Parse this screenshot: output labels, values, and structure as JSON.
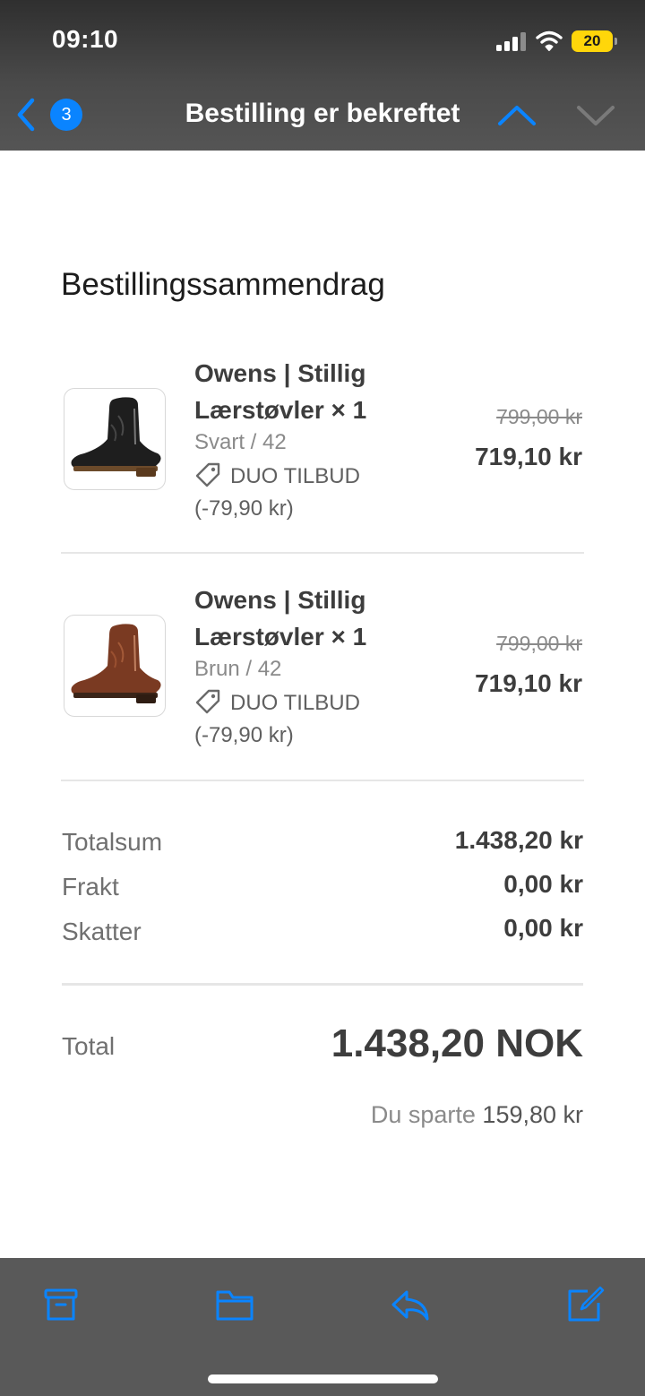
{
  "status_bar": {
    "time": "09:10",
    "battery": "20",
    "icons": [
      "signal-icon",
      "wifi-icon",
      "battery-icon"
    ]
  },
  "nav": {
    "title": "Bestilling er bekreftet",
    "badge_count": "3",
    "icons": [
      "chevron-left-icon",
      "chevron-up-icon",
      "chevron-down-icon"
    ]
  },
  "summary": {
    "heading": "Bestillingssammendrag",
    "items": [
      {
        "name": "Owens | Stillig Lærstøvler × 1",
        "variant": "Svart / 42",
        "discount_label": "DUO TILBUD",
        "discount_amount": "(-79,90 kr)",
        "price_original": "799,00 kr",
        "price_final": "719,10 kr",
        "color": "#1e1e1e"
      },
      {
        "name": "Owens | Stillig Lærstøvler × 1",
        "variant": "Brun / 42",
        "discount_label": "DUO TILBUD",
        "discount_amount": "(-79,90 kr)",
        "price_original": "799,00 kr",
        "price_final": "719,10 kr",
        "color": "#7a3a22"
      }
    ],
    "lines": [
      {
        "label": "Totalsum",
        "value": "1.438,20 kr"
      },
      {
        "label": "Frakt",
        "value": "0,00 kr"
      },
      {
        "label": "Skatter",
        "value": "0,00 kr"
      }
    ],
    "total_label": "Total",
    "total_value": "1.438,20 NOK",
    "saved_prefix": "Du sparte",
    "saved_amount": "159,80 kr"
  },
  "toolbar": {
    "icons": [
      "archive-icon",
      "folder-icon",
      "reply-icon",
      "compose-icon"
    ]
  },
  "colors": {
    "accent": "#0a84ff",
    "header_bg": "#4a4a4a",
    "toolbar_bg": "#595959",
    "battery": "#ffd60a"
  }
}
